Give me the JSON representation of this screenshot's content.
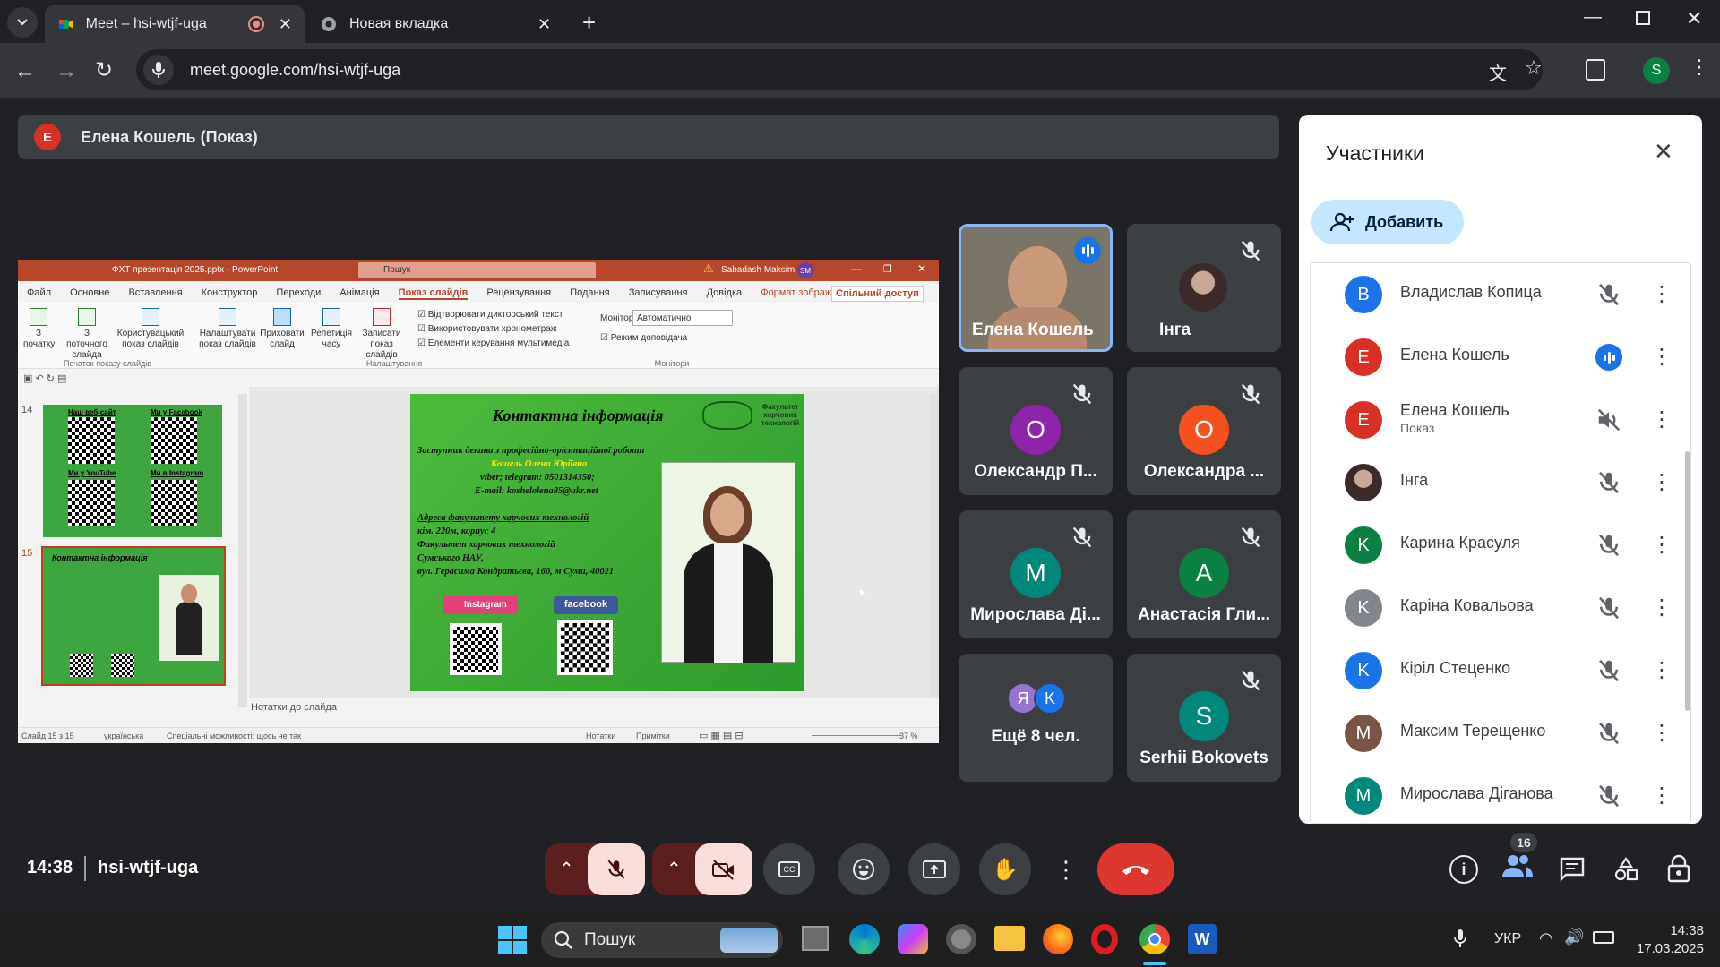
{
  "browser": {
    "tabs": [
      {
        "title": "Meet – hsi-wtjf-uga",
        "active": true
      },
      {
        "title": "Новая вкладка",
        "active": false
      }
    ],
    "url": "meet.google.com/hsi-wtjf-uga",
    "profile_initial": "S"
  },
  "meet": {
    "presenter_label": "Елена Кошель (Показ)",
    "presenter_initial": "E",
    "time": "14:38",
    "meeting_code": "hsi-wtjf-uga",
    "participant_count": "16",
    "tiles": [
      {
        "name": "Елена Кошель",
        "initial": "",
        "color": "",
        "speaking": true,
        "video": true
      },
      {
        "name": "Інга",
        "initial": "",
        "color": "",
        "speaking": false,
        "photo": true
      },
      {
        "name": "Олександр П...",
        "initial": "O",
        "color": "#8e24aa"
      },
      {
        "name": "Олександра ...",
        "initial": "O",
        "color": "#f4511e"
      },
      {
        "name": "Мирослава Ді...",
        "initial": "M",
        "color": "#00897b"
      },
      {
        "name": "Анастасія Гли...",
        "initial": "A",
        "color": "#0b8043"
      },
      {
        "name": "Ещё 8 чел.",
        "initials": [
          "Я",
          "K"
        ]
      },
      {
        "name": "Serhii Bokovets",
        "initial": "S",
        "color": "#00897b"
      }
    ]
  },
  "panel": {
    "title": "Участники",
    "add_label": "Добавить",
    "participants": [
      {
        "name": "Владислав Копица",
        "initial": "B",
        "color": "#1a73e8",
        "sub": "",
        "mic": "off"
      },
      {
        "name": "Елена Кошель",
        "initial": "E",
        "color": "#d93025",
        "sub": "",
        "mic": "speaking"
      },
      {
        "name": "Елена Кошель",
        "initial": "E",
        "color": "#d93025",
        "sub": "Показ",
        "mic": "muted-audio"
      },
      {
        "name": "Інга",
        "initial": "",
        "color": "#444",
        "sub": "",
        "mic": "off",
        "photo": true
      },
      {
        "name": "Карина Красуля",
        "initial": "K",
        "color": "#0b8043",
        "sub": "",
        "mic": "off"
      },
      {
        "name": "Каріна Ковальова",
        "initial": "K",
        "color": "#80868b",
        "sub": "",
        "mic": "off"
      },
      {
        "name": "Кірiл Стеценко",
        "initial": "K",
        "color": "#1a73e8",
        "sub": "",
        "mic": "off"
      },
      {
        "name": "Максим Терещенко",
        "initial": "M",
        "color": "#795548",
        "sub": "",
        "mic": "off"
      },
      {
        "name": "Мирослава Діганова",
        "initial": "M",
        "color": "#00897b",
        "sub": "",
        "mic": "off"
      }
    ]
  },
  "ppt": {
    "window_title": "ФХТ презентація 2025.pptx - PowerPoint",
    "search_placeholder": "Пошук",
    "user": "Sabadash Maksim",
    "user_initials": "SM",
    "menu": [
      "Файл",
      "Основне",
      "Вставлення",
      "Конструктор",
      "Переходи",
      "Анімація",
      "Показ слайдів",
      "Рецензування",
      "Подання",
      "Записування",
      "Довідка",
      "Формат зображення"
    ],
    "share": "Спільний доступ",
    "ribbon": {
      "from_start": "З початку",
      "from_current": "З поточного слайда",
      "custom": "Користувацький показ слайдів",
      "group1": "Початок показу слайдів",
      "setup": "Налаштувати показ слайдів",
      "hide": "Приховати слайд",
      "rehearse": "Репетиція часу",
      "record": "Записати показ слайдів",
      "chk1": "Відтворювати дикторський текст",
      "chk2": "Використовувати хронометраж",
      "chk3": "Елементи керування мультимедіа",
      "group2": "Налаштування",
      "monitor_label": "Монітор:",
      "monitor_value": "Автоматично",
      "presenter_view": "Режим доповідача",
      "group3": "Монітори"
    },
    "slide_numbers": [
      "14",
      "15"
    ],
    "thumb14": {
      "t1": "Наш веб-сайт",
      "t2": "Ми у Facebook",
      "t3": "Ми у YouTube",
      "t4": "Ми в Instagram"
    },
    "slide": {
      "title": "Контактна інформація",
      "faculty": "Факультет харчових технологій",
      "position": "Заступник декана з професійно-орієнтаційної роботи",
      "person": "Кошель Олена Юріївна",
      "phone": "viber; telegram: 0501314350;",
      "email": "E-mail: koshelolena85@ukr.net",
      "addr_head": "Адреса факультету харчових технологій",
      "addr1": "кім. 220м, корпус 4",
      "addr2": "Факультет харчових технологій",
      "addr3": "Сумського НАУ,",
      "addr4": "вул. Герасима Кондратьєва, 160, м Суми, 40021",
      "instagram": "Instagram",
      "facebook": "facebook"
    },
    "notes": "Нотатки до слайда",
    "status_left": "Слайд 15 з 15",
    "status_lang": "українська",
    "status_access": "Спеціальні можливості: щось не так",
    "status_notes": "Нотатки",
    "status_comments": "Примітки",
    "zoom": "37 %"
  },
  "taskbar": {
    "search": "Пошук",
    "lang": "УКР",
    "time": "14:38",
    "date": "17.03.2025"
  }
}
